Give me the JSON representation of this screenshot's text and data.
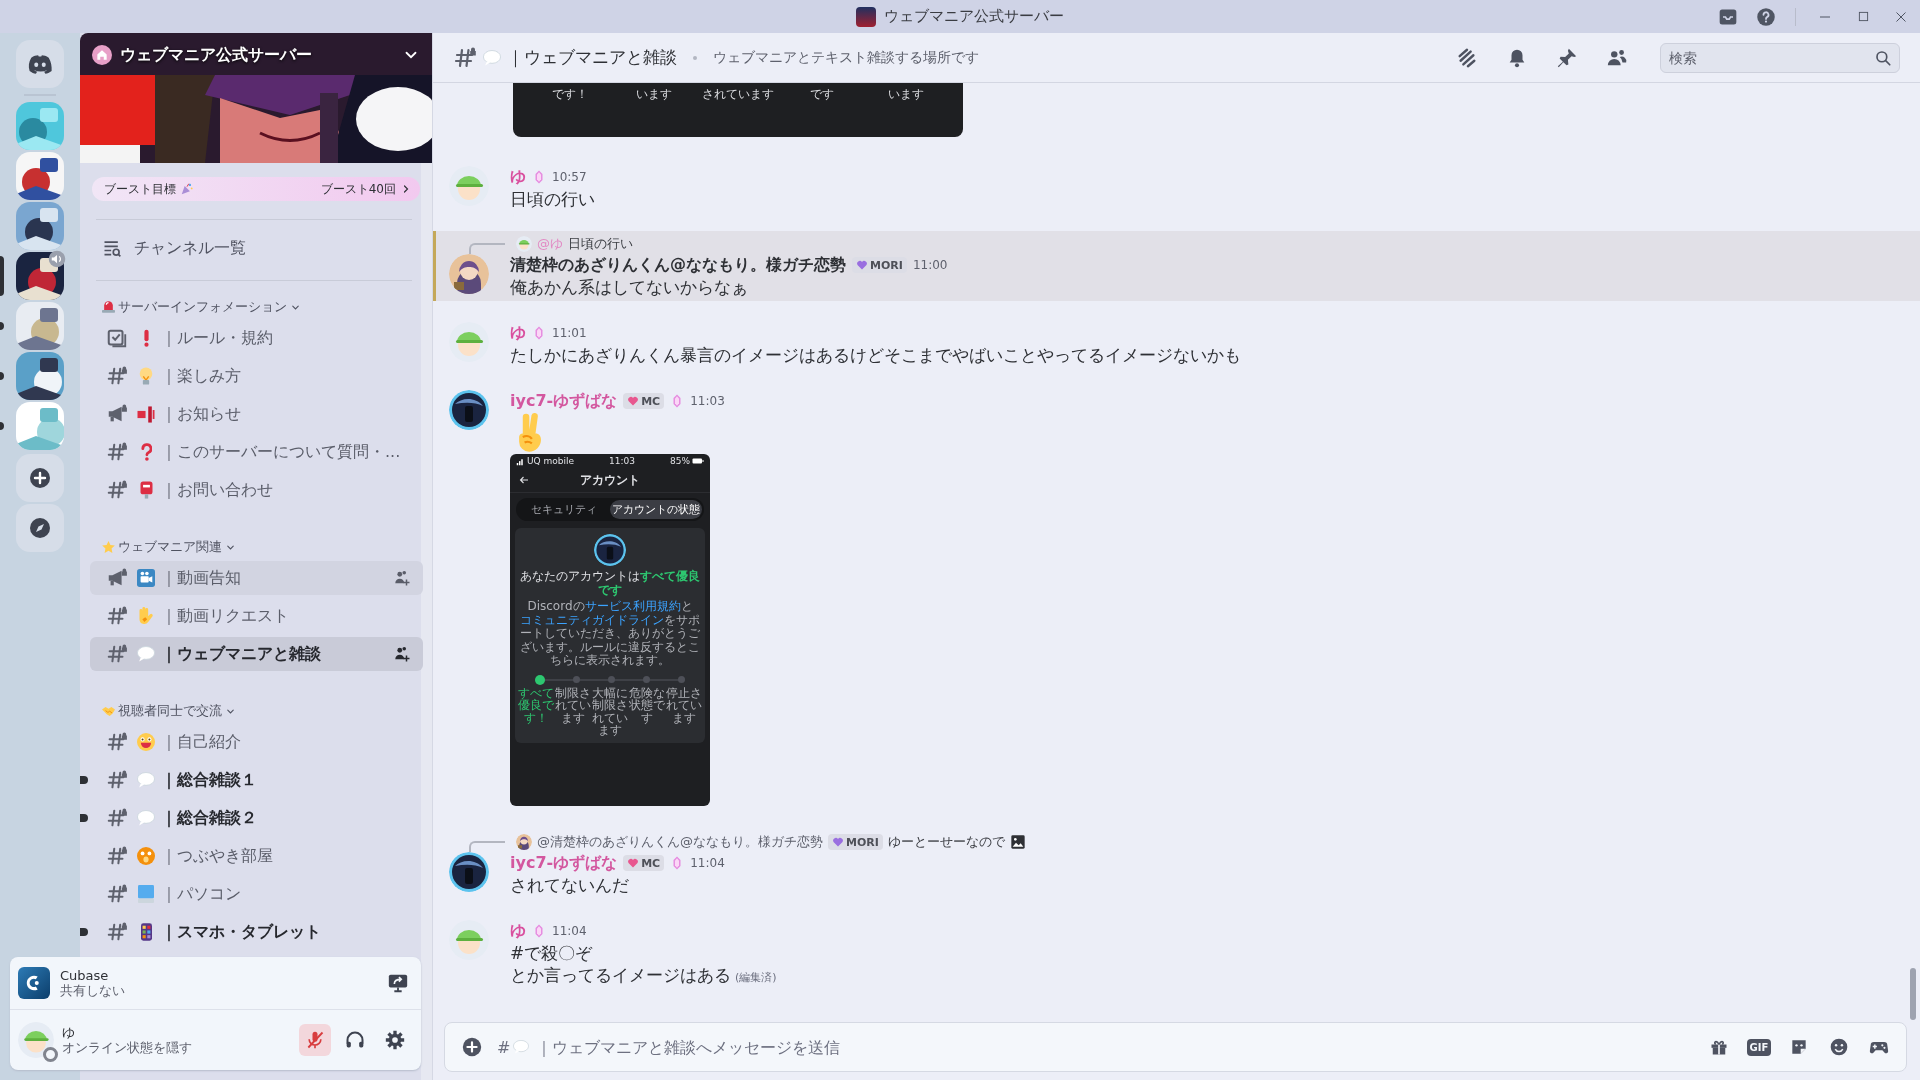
{
  "window": {
    "title": "ウェブマニア公式サーバー"
  },
  "servers": [
    {
      "kind": "home",
      "selected": false,
      "unread": false
    },
    {
      "kind": "server",
      "selected": false,
      "unread": false,
      "voice": false
    },
    {
      "kind": "server",
      "selected": false,
      "unread": false,
      "voice": false
    },
    {
      "kind": "server",
      "selected": false,
      "unread": false,
      "voice": false
    },
    {
      "kind": "server",
      "selected": true,
      "unread": false,
      "voice": true
    },
    {
      "kind": "server",
      "selected": false,
      "unread": true,
      "voice": false
    },
    {
      "kind": "server",
      "selected": false,
      "unread": true,
      "voice": false
    },
    {
      "kind": "server",
      "selected": false,
      "unread": true,
      "voice": false
    },
    {
      "kind": "add"
    },
    {
      "kind": "discover"
    }
  ],
  "sidebar": {
    "server_name": "ウェブマニア公式サーバー",
    "boost": {
      "label": "ブースト目標",
      "progress": "ブースト40回"
    },
    "browse_label": "チャンネル一覧",
    "categories": [
      {
        "name": "サーバーインフォメーション",
        "emoji": {
          "kind": "siren"
        },
        "channels": [
          {
            "kind": "rules",
            "emoji": {
              "kind": "exclamation"
            },
            "name": "｜ルール・規約",
            "selected": false,
            "highlighted": false,
            "unread": false,
            "invite": false
          },
          {
            "kind": "text",
            "emoji": {
              "kind": "bulb"
            },
            "name": "｜楽しみ方",
            "selected": false,
            "highlighted": false,
            "unread": false,
            "invite": false
          },
          {
            "kind": "announcement",
            "emoji": {
              "kind": "signal"
            },
            "name": "｜お知らせ",
            "selected": false,
            "highlighted": false,
            "unread": false,
            "invite": false
          },
          {
            "kind": "text",
            "emoji": {
              "kind": "question"
            },
            "name": "｜このサーバーについて質問・...",
            "selected": false,
            "highlighted": false,
            "unread": false,
            "invite": false
          },
          {
            "kind": "text",
            "emoji": {
              "kind": "postbox"
            },
            "name": "｜お問い合わせ",
            "selected": false,
            "highlighted": false,
            "unread": false,
            "invite": false
          }
        ]
      },
      {
        "name": "ウェブマニア関連",
        "emoji": {
          "kind": "star"
        },
        "channels": [
          {
            "kind": "announcement",
            "emoji": {
              "kind": "camera"
            },
            "name": "｜動画告知",
            "selected": false,
            "highlighted": true,
            "unread": false,
            "invite": true
          },
          {
            "kind": "text",
            "emoji": {
              "kind": "hand"
            },
            "name": "｜動画リクエスト",
            "selected": false,
            "highlighted": false,
            "unread": false,
            "invite": false
          },
          {
            "kind": "text",
            "emoji": {
              "kind": "speech"
            },
            "name": "｜ウェブマニアと雑談",
            "selected": true,
            "highlighted": false,
            "unread": false,
            "invite": true
          }
        ]
      },
      {
        "name": "視聴者同士で交流",
        "emoji": {
          "kind": "handshake"
        },
        "channels": [
          {
            "kind": "text",
            "emoji": {
              "kind": "grin"
            },
            "name": "｜自己紹介",
            "selected": false,
            "highlighted": false,
            "unread": false,
            "invite": false
          },
          {
            "kind": "text",
            "emoji": {
              "kind": "speech"
            },
            "name": "｜総合雑談１",
            "selected": false,
            "highlighted": false,
            "unread": true,
            "invite": false
          },
          {
            "kind": "text",
            "emoji": {
              "kind": "speech"
            },
            "name": "｜総合雑談２",
            "selected": false,
            "highlighted": false,
            "unread": true,
            "invite": false
          },
          {
            "kind": "text",
            "emoji": {
              "kind": "surprised"
            },
            "name": "｜つぶやき部屋",
            "selected": false,
            "highlighted": false,
            "unread": false,
            "invite": false
          },
          {
            "kind": "text",
            "emoji": {
              "kind": "computer"
            },
            "name": "｜パソコン",
            "selected": false,
            "highlighted": false,
            "unread": false,
            "invite": false
          },
          {
            "kind": "text",
            "emoji": {
              "kind": "phone"
            },
            "name": "｜スマホ・タブレット",
            "selected": false,
            "highlighted": false,
            "unread": true,
            "invite": false
          }
        ]
      }
    ]
  },
  "activity": {
    "app": "Cubase",
    "status": "共有しない"
  },
  "user": {
    "name": "ゆ",
    "status_text": "オンライン状態を隠す",
    "invisible": true,
    "muted": true,
    "deafened": false
  },
  "chat": {
    "channel": {
      "emoji": {
        "kind": "speech"
      },
      "name": "｜ウェブマニアと雑談",
      "topic": "ウェブマニアとテキスト雑談する場所です"
    },
    "search": {
      "placeholder": "検索"
    },
    "messages": [
      {
        "kind": "image-tail",
        "labels": [
          "です！",
          "います",
          "されています",
          "です",
          "います"
        ]
      },
      {
        "kind": "message",
        "avatar": {
          "kind": "cap"
        },
        "author": {
          "name": "ゆ",
          "color": "#d9509f"
        },
        "gem": true,
        "time": "10:57",
        "lines": [
          "日頃の行い"
        ],
        "highlighted": false
      },
      {
        "kind": "message",
        "avatar": {
          "kind": "purple"
        },
        "reply": {
          "avatar": {
            "kind": "cap"
          },
          "mention": "@ゆ",
          "color": "#e28ac4",
          "text": "日頃の行い"
        },
        "author": {
          "name": "清楚枠のあざりんくん@ななもり。様ガチ恋勢",
          "color": "#2e3035"
        },
        "role": {
          "name": "MORI",
          "color": "#9a6fe0"
        },
        "gem": false,
        "time": "11:00",
        "lines": [
          "俺あかん系はしてないからなぁ"
        ],
        "highlighted": true
      },
      {
        "kind": "message",
        "avatar": {
          "kind": "cap"
        },
        "author": {
          "name": "ゆ",
          "color": "#d9509f"
        },
        "gem": true,
        "time": "11:01",
        "lines": [
          "たしかにあざりんくん暴言のイメージはあるけどそこまでやばいことやってるイメージないかも"
        ],
        "highlighted": false
      },
      {
        "kind": "message",
        "avatar": {
          "kind": "dark"
        },
        "author": {
          "name": "iyc7-ゆずばな",
          "color": "#d3579f"
        },
        "role": {
          "name": "MC",
          "color": "#e8578f"
        },
        "gem": true,
        "time": "11:03",
        "big_emoji": {
          "kind": "peace"
        },
        "screenshot": {
          "carrier": "UQ mobile",
          "clock": "11:03",
          "battery": "85%",
          "title": "アカウント",
          "tabs": [
            {
              "label": "セキュリティ",
              "selected": false
            },
            {
              "label": "アカウントの状態",
              "selected": true
            }
          ],
          "headline": "あなたのアカウントは**すべて優良です**",
          "body": [
            {
              "kind": "text",
              "text": "Discordの"
            },
            {
              "kind": "link",
              "text": "サービス利用規約"
            },
            {
              "kind": "text",
              "text": "と"
            },
            {
              "kind": "link",
              "text": "コミュニティガイドライン"
            },
            {
              "kind": "text",
              "text": "をサポートしていただき、ありがとうございます。ルールに違反するとこちらに表示されます。"
            }
          ],
          "steps": [
            {
              "label": "すべて優良です！",
              "selected": true
            },
            {
              "label": "制限されています",
              "selected": false
            },
            {
              "label": "大幅に制限されています",
              "selected": false
            },
            {
              "label": "危険な状態です",
              "selected": false
            },
            {
              "label": "停止されています",
              "selected": false
            }
          ]
        },
        "highlighted": false
      },
      {
        "kind": "message",
        "avatar": {
          "kind": "dark"
        },
        "reply": {
          "avatar": {
            "kind": "purple"
          },
          "mention": "@清楚枠のあざりんくん@ななもり。様ガチ恋勢",
          "color": "#5c5f6b",
          "role": {
            "name": "MORI",
            "color": "#9a6fe0"
          },
          "text": "ゆーとーせーなので",
          "attachment": true
        },
        "author": {
          "name": "iyc7-ゆずばな",
          "color": "#d3579f"
        },
        "role": {
          "name": "MC",
          "color": "#e8578f"
        },
        "gem": true,
        "time": "11:04",
        "lines": [
          "されてないんだ"
        ],
        "highlighted": false
      },
      {
        "kind": "message",
        "avatar": {
          "kind": "cap"
        },
        "author": {
          "name": "ゆ",
          "color": "#d9509f"
        },
        "gem": true,
        "time": "11:04",
        "lines": [
          "#で殺〇ぞ",
          "とか言ってるイメージはある"
        ],
        "edited": "(編集済)",
        "highlighted": false
      }
    ],
    "composer": {
      "prefix": "#",
      "emoji": {
        "kind": "speech"
      },
      "placeholder": "｜ウェブマニアと雑談へメッセージを送信",
      "gif_label": "GIF"
    }
  }
}
